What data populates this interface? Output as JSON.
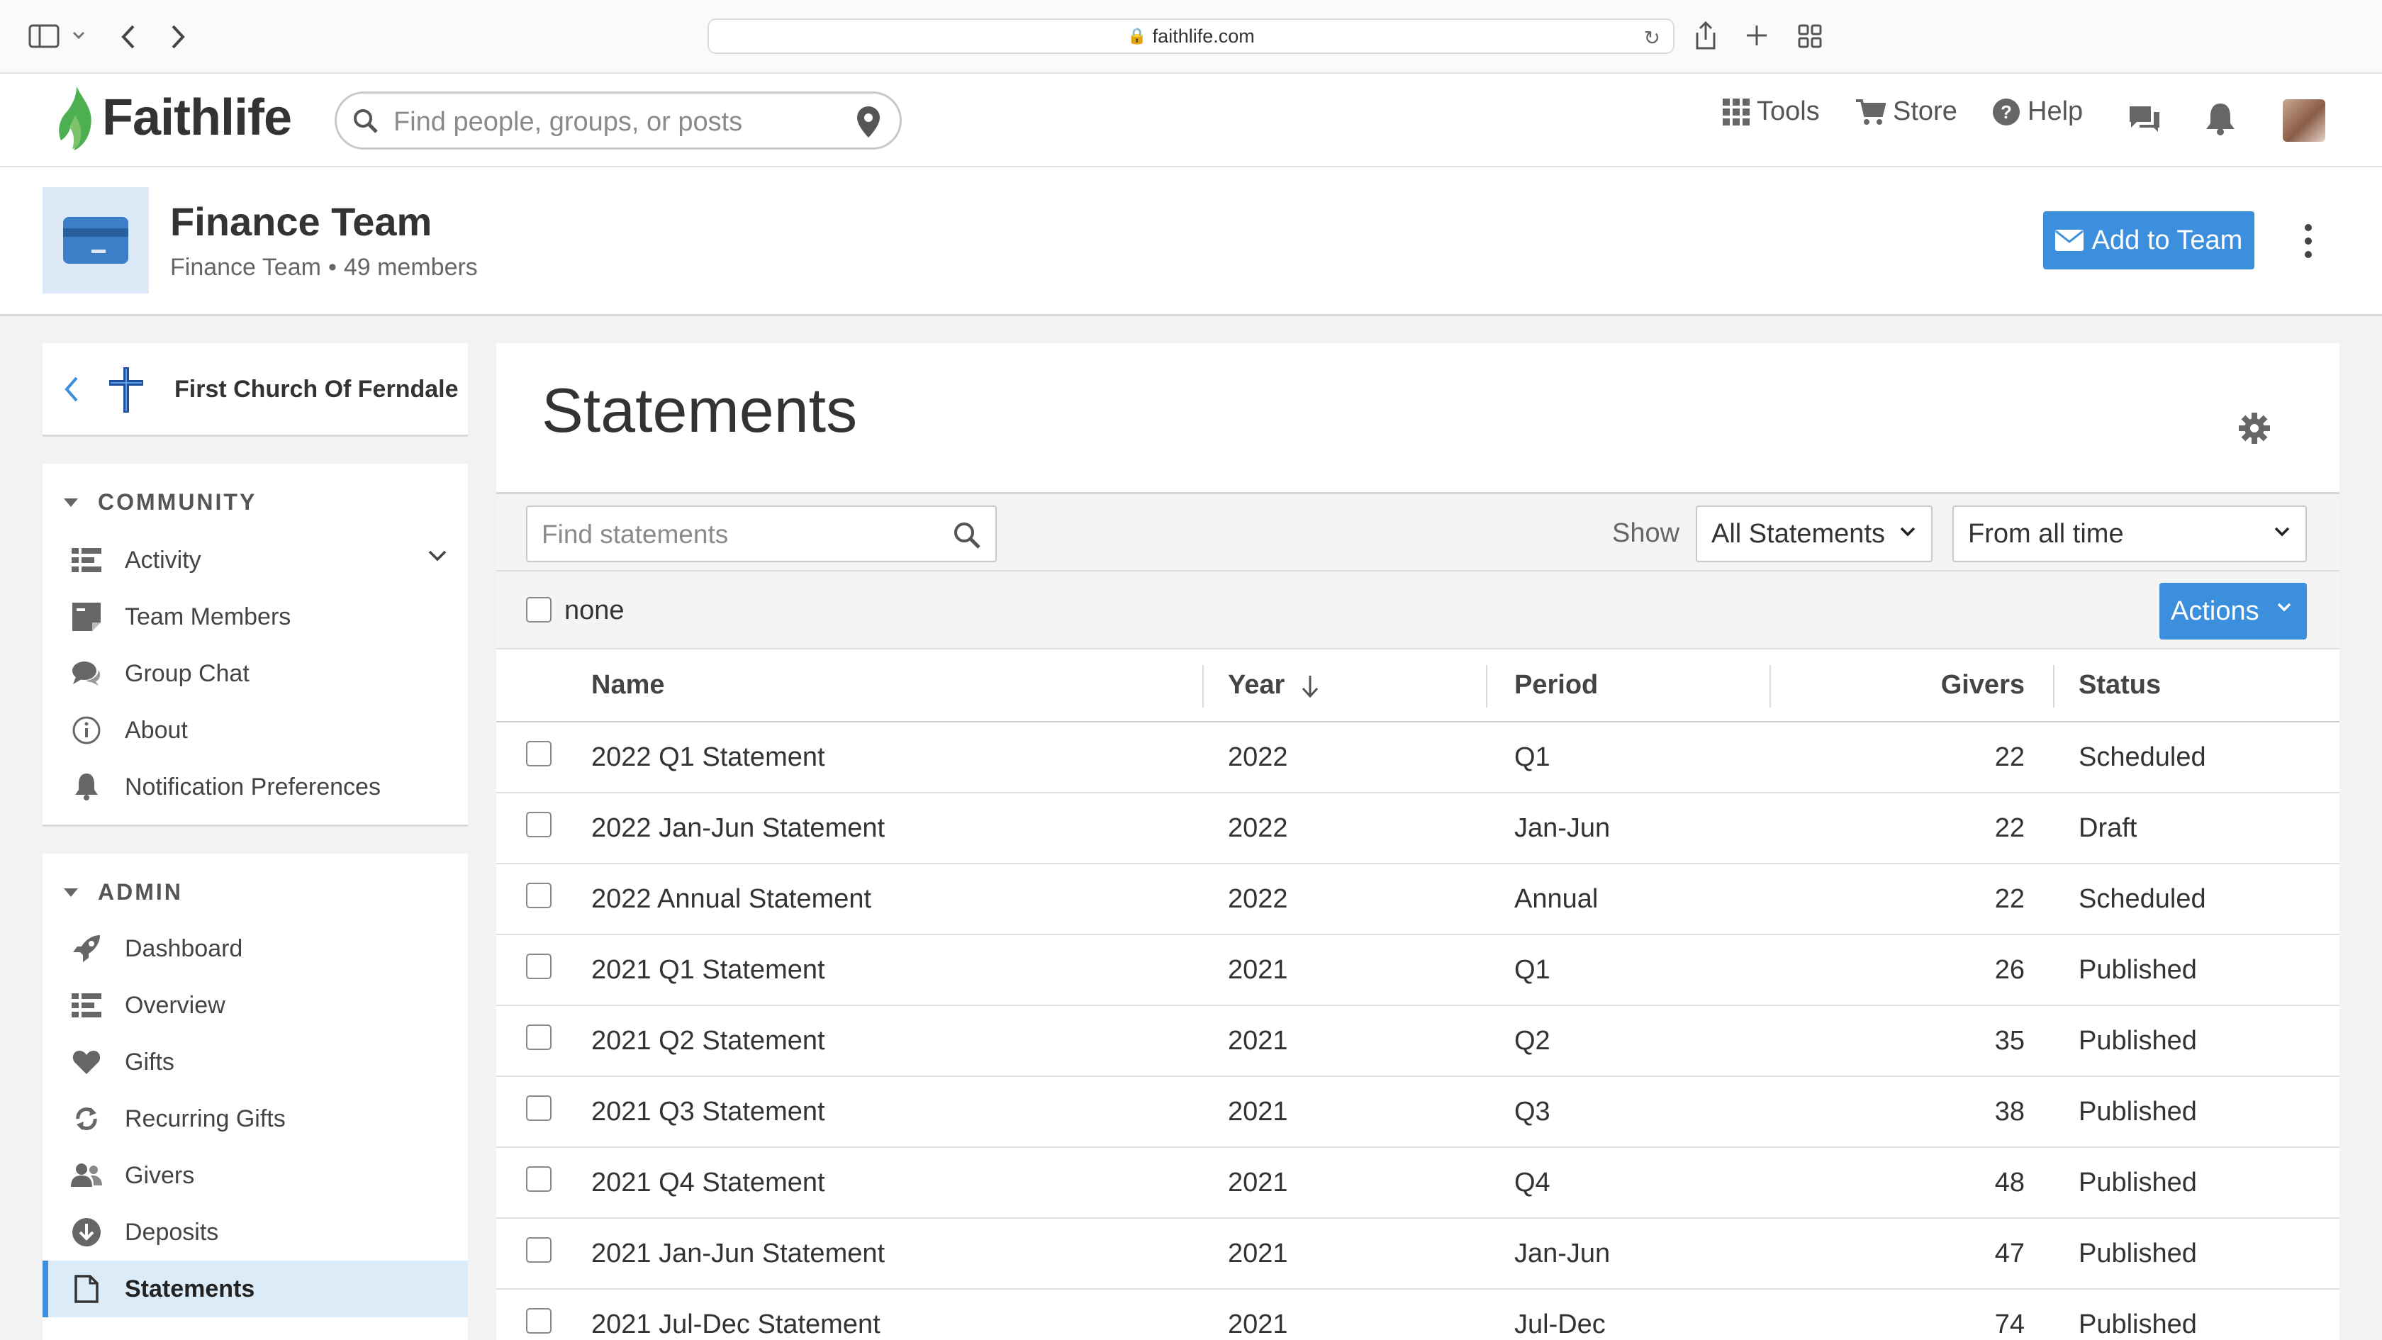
{
  "browser": {
    "url": "faithlife.com"
  },
  "header": {
    "brand": "Faithlife",
    "search_placeholder": "Find people, groups, or posts",
    "nav": {
      "tools": "Tools",
      "store": "Store",
      "help": "Help"
    }
  },
  "team": {
    "title": "Finance Team",
    "subtitle": "Finance Team",
    "members": "49 members",
    "add_button": "Add to Team"
  },
  "sidebar": {
    "church_name": "First Church Of Ferndale",
    "community_title": "COMMUNITY",
    "community_items": [
      "Activity",
      "Team Members",
      "Group Chat",
      "About",
      "Notification Preferences"
    ],
    "admin_title": "ADMIN",
    "admin_items": [
      "Dashboard",
      "Overview",
      "Gifts",
      "Recurring Gifts",
      "Givers",
      "Deposits",
      "Statements"
    ],
    "active_item": "Statements"
  },
  "main": {
    "title": "Statements",
    "find_placeholder": "Find statements",
    "show_label": "Show",
    "show_value": "All Statements",
    "time_value": "From all time",
    "select_label": "none",
    "actions_label": "Actions",
    "columns": {
      "name": "Name",
      "year": "Year",
      "period": "Period",
      "givers": "Givers",
      "status": "Status"
    },
    "rows": [
      {
        "name": "2022 Q1 Statement",
        "year": "2022",
        "period": "Q1",
        "givers": "22",
        "status": "Scheduled"
      },
      {
        "name": "2022 Jan-Jun Statement",
        "year": "2022",
        "period": "Jan-Jun",
        "givers": "22",
        "status": "Draft"
      },
      {
        "name": "2022 Annual Statement",
        "year": "2022",
        "period": "Annual",
        "givers": "22",
        "status": "Scheduled"
      },
      {
        "name": "2021 Q1 Statement",
        "year": "2021",
        "period": "Q1",
        "givers": "26",
        "status": "Published"
      },
      {
        "name": "2021 Q2 Statement",
        "year": "2021",
        "period": "Q2",
        "givers": "35",
        "status": "Published"
      },
      {
        "name": "2021 Q3 Statement",
        "year": "2021",
        "period": "Q3",
        "givers": "38",
        "status": "Published"
      },
      {
        "name": "2021 Q4 Statement",
        "year": "2021",
        "period": "Q4",
        "givers": "48",
        "status": "Published"
      },
      {
        "name": "2021 Jan-Jun Statement",
        "year": "2021",
        "period": "Jan-Jun",
        "givers": "47",
        "status": "Published"
      },
      {
        "name": "2021 Jul-Dec Statement",
        "year": "2021",
        "period": "Jul-Dec",
        "givers": "74",
        "status": "Published"
      }
    ]
  },
  "colors": {
    "accent": "#3c8fdc",
    "active_bg": "#dcebf8",
    "brand_green": "#4caf50"
  }
}
